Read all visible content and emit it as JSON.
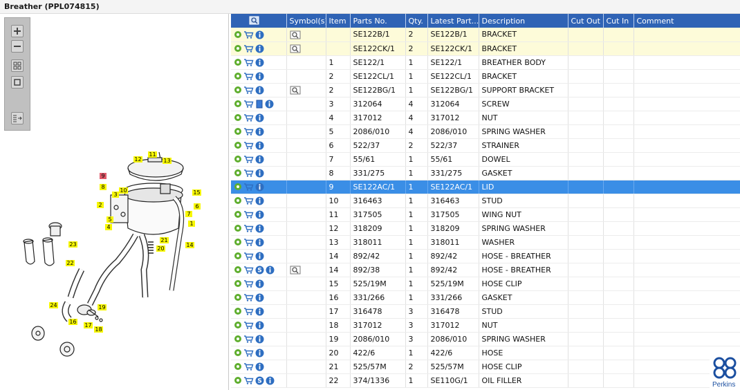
{
  "window": {
    "title": "Breather (PPL074815)"
  },
  "toolbar": {
    "buttons": [
      {
        "name": "zoom-in",
        "icon": "plus-icon"
      },
      {
        "name": "zoom-out",
        "icon": "minus-icon"
      },
      {
        "name": "fit-all",
        "icon": "grid-icon"
      },
      {
        "name": "actual-size",
        "icon": "square-icon"
      },
      {
        "name": "export",
        "icon": "list-arrow-icon"
      }
    ]
  },
  "diagram": {
    "callouts": [
      "1",
      "2",
      "3",
      "4",
      "5",
      "6",
      "7",
      "8",
      "9",
      "10",
      "11",
      "12",
      "13",
      "14",
      "15",
      "16",
      "17",
      "18",
      "19",
      "20",
      "21",
      "22",
      "23",
      "24"
    ],
    "selected": "9"
  },
  "table": {
    "columns": [
      "",
      "Symbol(s)",
      "Item",
      "Parts No.",
      "Qty.",
      "Latest Part...",
      "Description",
      "Cut Out",
      "Cut In",
      "Comment"
    ],
    "rows": [
      {
        "item": "",
        "part": "SE122B/1",
        "qty": "2",
        "latest": "SE122B/1",
        "desc": "BRACKET",
        "cut_out": "",
        "cut_in": "",
        "comment": "",
        "book": false,
        "s": false,
        "lens": true,
        "hl": true
      },
      {
        "item": "",
        "part": "SE122CK/1",
        "qty": "2",
        "latest": "SE122CK/1",
        "desc": "BRACKET",
        "cut_out": "",
        "cut_in": "",
        "comment": "",
        "book": false,
        "s": false,
        "lens": true,
        "hl": true
      },
      {
        "item": "1",
        "part": "SE122/1",
        "qty": "1",
        "latest": "SE122/1",
        "desc": "BREATHER BODY",
        "cut_out": "",
        "cut_in": "",
        "comment": "",
        "book": false,
        "s": false,
        "lens": false
      },
      {
        "item": "2",
        "part": "SE122CL/1",
        "qty": "1",
        "latest": "SE122CL/1",
        "desc": "BRACKET",
        "cut_out": "",
        "cut_in": "",
        "comment": "",
        "book": false,
        "s": false,
        "lens": false
      },
      {
        "item": "2",
        "part": "SE122BG/1",
        "qty": "1",
        "latest": "SE122BG/1",
        "desc": "SUPPORT BRACKET",
        "cut_out": "",
        "cut_in": "",
        "comment": "",
        "book": false,
        "s": false,
        "lens": true
      },
      {
        "item": "3",
        "part": "312064",
        "qty": "4",
        "latest": "312064",
        "desc": "SCREW",
        "cut_out": "",
        "cut_in": "",
        "comment": "",
        "book": true,
        "s": false,
        "lens": false
      },
      {
        "item": "4",
        "part": "317012",
        "qty": "4",
        "latest": "317012",
        "desc": "NUT",
        "cut_out": "",
        "cut_in": "",
        "comment": "",
        "book": false,
        "s": false,
        "lens": false
      },
      {
        "item": "5",
        "part": "2086/010",
        "qty": "4",
        "latest": "2086/010",
        "desc": "SPRING WASHER",
        "cut_out": "",
        "cut_in": "",
        "comment": "",
        "book": false,
        "s": false,
        "lens": false
      },
      {
        "item": "6",
        "part": "522/37",
        "qty": "2",
        "latest": "522/37",
        "desc": "STRAINER",
        "cut_out": "",
        "cut_in": "",
        "comment": "",
        "book": false,
        "s": false,
        "lens": false
      },
      {
        "item": "7",
        "part": "55/61",
        "qty": "1",
        "latest": "55/61",
        "desc": "DOWEL",
        "cut_out": "",
        "cut_in": "",
        "comment": "",
        "book": false,
        "s": false,
        "lens": false
      },
      {
        "item": "8",
        "part": "331/275",
        "qty": "1",
        "latest": "331/275",
        "desc": "GASKET",
        "cut_out": "",
        "cut_in": "",
        "comment": "",
        "book": false,
        "s": false,
        "lens": false
      },
      {
        "item": "9",
        "part": "SE122AC/1",
        "qty": "1",
        "latest": "SE122AC/1",
        "desc": "LID",
        "cut_out": "",
        "cut_in": "",
        "comment": "",
        "book": false,
        "s": false,
        "lens": false,
        "sel": true
      },
      {
        "item": "10",
        "part": "316463",
        "qty": "1",
        "latest": "316463",
        "desc": "STUD",
        "cut_out": "",
        "cut_in": "",
        "comment": "",
        "book": false,
        "s": false,
        "lens": false
      },
      {
        "item": "11",
        "part": "317505",
        "qty": "1",
        "latest": "317505",
        "desc": "WING NUT",
        "cut_out": "",
        "cut_in": "",
        "comment": "",
        "book": false,
        "s": false,
        "lens": false
      },
      {
        "item": "12",
        "part": "318209",
        "qty": "1",
        "latest": "318209",
        "desc": "SPRING WASHER",
        "cut_out": "",
        "cut_in": "",
        "comment": "",
        "book": false,
        "s": false,
        "lens": false
      },
      {
        "item": "13",
        "part": "318011",
        "qty": "1",
        "latest": "318011",
        "desc": "WASHER",
        "cut_out": "",
        "cut_in": "",
        "comment": "",
        "book": false,
        "s": false,
        "lens": false
      },
      {
        "item": "14",
        "part": "892/42",
        "qty": "1",
        "latest": "892/42",
        "desc": "HOSE - BREATHER",
        "cut_out": "",
        "cut_in": "",
        "comment": "",
        "book": false,
        "s": false,
        "lens": false
      },
      {
        "item": "14",
        "part": "892/38",
        "qty": "1",
        "latest": "892/42",
        "desc": "HOSE - BREATHER",
        "cut_out": "",
        "cut_in": "",
        "comment": "",
        "book": false,
        "s": true,
        "lens": true
      },
      {
        "item": "15",
        "part": "525/19M",
        "qty": "1",
        "latest": "525/19M",
        "desc": "HOSE CLIP",
        "cut_out": "",
        "cut_in": "",
        "comment": "",
        "book": false,
        "s": false,
        "lens": false
      },
      {
        "item": "16",
        "part": "331/266",
        "qty": "1",
        "latest": "331/266",
        "desc": "GASKET",
        "cut_out": "",
        "cut_in": "",
        "comment": "",
        "book": false,
        "s": false,
        "lens": false
      },
      {
        "item": "17",
        "part": "316478",
        "qty": "3",
        "latest": "316478",
        "desc": "STUD",
        "cut_out": "",
        "cut_in": "",
        "comment": "",
        "book": false,
        "s": false,
        "lens": false
      },
      {
        "item": "18",
        "part": "317012",
        "qty": "3",
        "latest": "317012",
        "desc": "NUT",
        "cut_out": "",
        "cut_in": "",
        "comment": "",
        "book": false,
        "s": false,
        "lens": false
      },
      {
        "item": "19",
        "part": "2086/010",
        "qty": "3",
        "latest": "2086/010",
        "desc": "SPRING WASHER",
        "cut_out": "",
        "cut_in": "",
        "comment": "",
        "book": false,
        "s": false,
        "lens": false
      },
      {
        "item": "20",
        "part": "422/6",
        "qty": "1",
        "latest": "422/6",
        "desc": "HOSE",
        "cut_out": "",
        "cut_in": "",
        "comment": "",
        "book": false,
        "s": false,
        "lens": false
      },
      {
        "item": "21",
        "part": "525/57M",
        "qty": "2",
        "latest": "525/57M",
        "desc": "HOSE CLIP",
        "cut_out": "",
        "cut_in": "",
        "comment": "",
        "book": false,
        "s": false,
        "lens": false
      },
      {
        "item": "22",
        "part": "374/1336",
        "qty": "1",
        "latest": "SE110G/1",
        "desc": "OIL FILLER",
        "cut_out": "",
        "cut_in": "",
        "comment": "",
        "book": false,
        "s": true,
        "lens": false
      }
    ]
  },
  "icons": {
    "s_badge_letter": "S"
  },
  "brand": {
    "name": "Perkins",
    "color": "#1b4fa0"
  },
  "colors": {
    "header": "#2f63b5",
    "selected_row": "#3a8ee6",
    "highlight_row": "#fdfbd9",
    "callout": "#f7f700",
    "callout_selected": "#e05a6a"
  }
}
